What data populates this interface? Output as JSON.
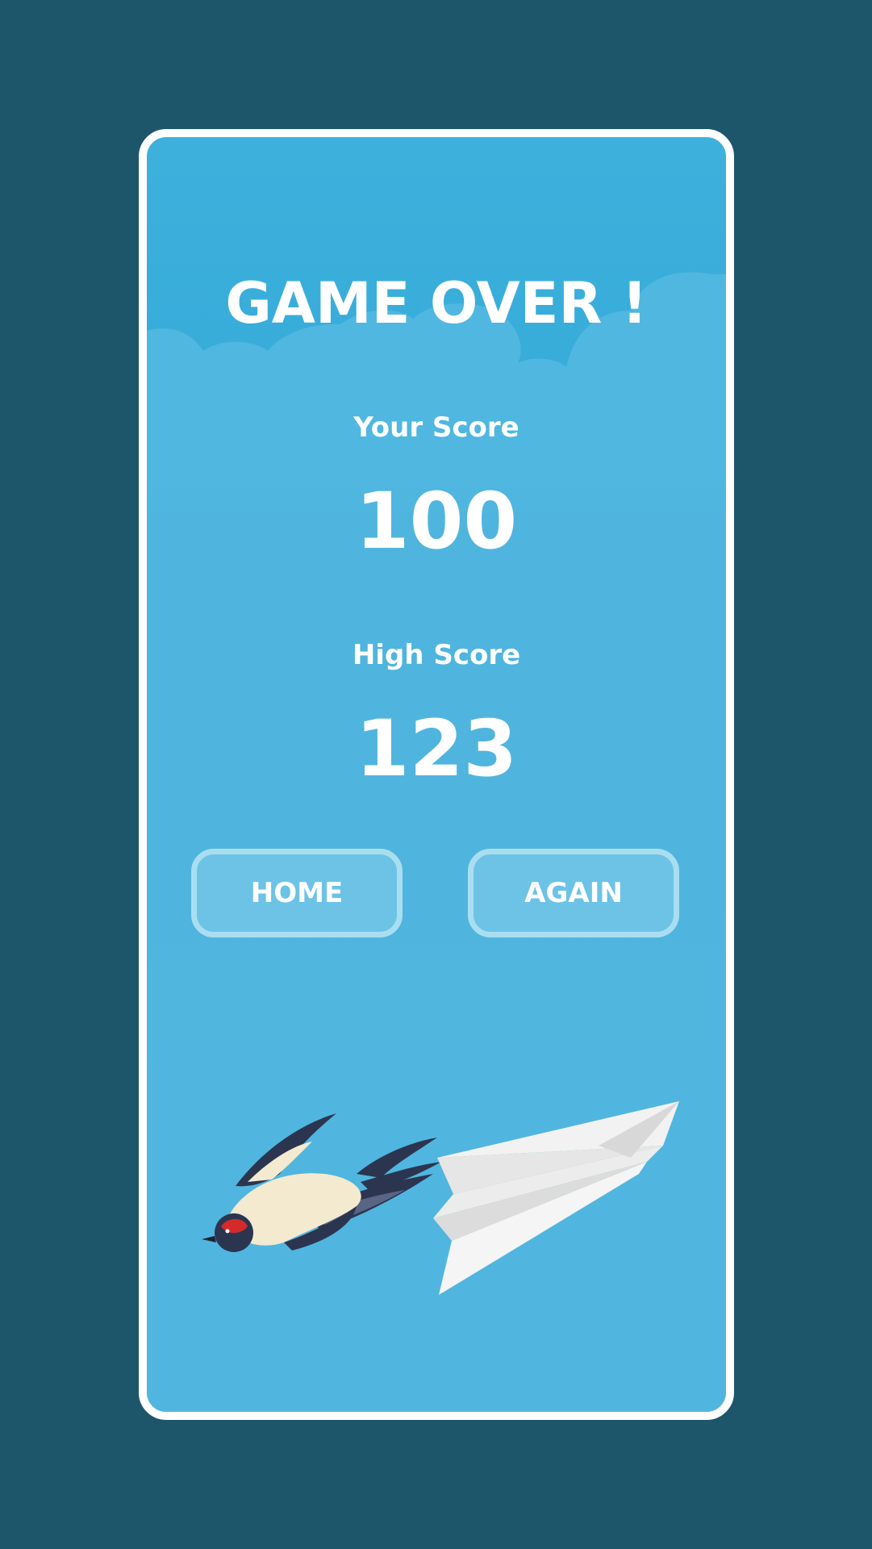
{
  "game_over": {
    "title": "GAME OVER !",
    "your_score_label": "Your Score",
    "your_score": "100",
    "high_score_label": "High Score",
    "high_score": "123",
    "buttons": {
      "home": "HOME",
      "again": "AGAIN"
    }
  },
  "colors": {
    "page_background": "#1d566b",
    "sky": "#30a8d8",
    "cloud": "#55b8e0",
    "card_border": "#ffffff",
    "button_border": "#a9def1",
    "text": "#ffffff"
  },
  "icons": {
    "bird": "swallow-bird-icon",
    "plane": "paper-plane-icon"
  }
}
